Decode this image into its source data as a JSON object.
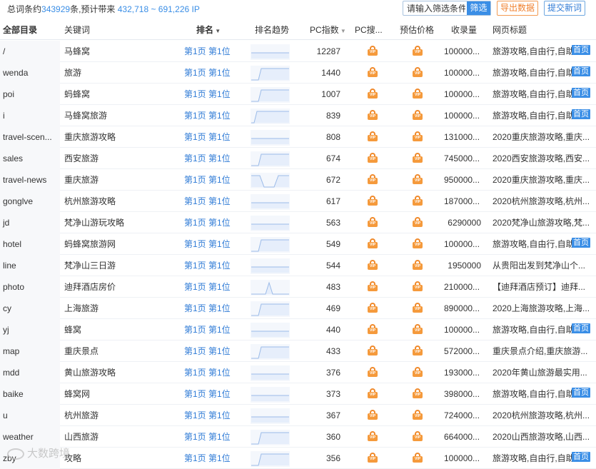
{
  "summary": {
    "prefix": "总词条约",
    "count": "343929",
    "middle": "条,预计带来 ",
    "ip_range": "432,718 ~ 691,226",
    "suffix": " IP"
  },
  "toolbar": {
    "filter_placeholder": "请输入筛选条件",
    "filter_label": "筛选",
    "export_label": "导出数据",
    "submit_label": "提交新词"
  },
  "columns": {
    "dir": "全部目录",
    "keyword": "关键词",
    "rank": "排名",
    "trend": "排名趋势",
    "pc_index": "PC指数",
    "pc_search": "PC搜...",
    "price": "预估价格",
    "volume": "收录量",
    "title": "网页标题"
  },
  "badge_label": "首页",
  "rows": [
    {
      "dir": "/",
      "keyword": "马蜂窝",
      "rank": "第1页 第1位",
      "trend": "flat",
      "pc": "12287",
      "volume": "100000...",
      "title": "旅游攻略,自由行,自助",
      "badge": true
    },
    {
      "dir": "wenda",
      "keyword": "旅游",
      "rank": "第1页 第1位",
      "trend": "rise",
      "pc": "1440",
      "volume": "100000...",
      "title": "旅游攻略,自由行,自助",
      "badge": true
    },
    {
      "dir": "poi",
      "keyword": "蚂蜂窝",
      "rank": "第1页 第1位",
      "trend": "rise",
      "pc": "1007",
      "volume": "100000...",
      "title": "旅游攻略,自由行,自助",
      "badge": true
    },
    {
      "dir": "i",
      "keyword": "马蜂窝旅游",
      "rank": "第1页 第1位",
      "trend": "rise-early",
      "pc": "839",
      "volume": "100000...",
      "title": "旅游攻略,自由行,自助",
      "badge": true
    },
    {
      "dir": "travel-scen...",
      "keyword": "重庆旅游攻略",
      "rank": "第1页 第1位",
      "trend": "flat",
      "pc": "808",
      "volume": "131000...",
      "title": "2020重庆旅游攻略,重庆...",
      "badge": false
    },
    {
      "dir": "sales",
      "keyword": "西安旅游",
      "rank": "第1页 第1位",
      "trend": "rise",
      "pc": "674",
      "volume": "745000...",
      "title": "2020西安旅游攻略,西安...",
      "badge": false
    },
    {
      "dir": "travel-news",
      "keyword": "重庆旅游",
      "rank": "第1页 第1位",
      "trend": "dip",
      "pc": "672",
      "volume": "950000...",
      "title": "2020重庆旅游攻略,重庆...",
      "badge": false
    },
    {
      "dir": "gonglve",
      "keyword": "杭州旅游攻略",
      "rank": "第1页 第1位",
      "trend": "flat",
      "pc": "617",
      "volume": "187000...",
      "title": "2020杭州旅游攻略,杭州...",
      "badge": false
    },
    {
      "dir": "jd",
      "keyword": "梵净山游玩攻略",
      "rank": "第1页 第1位",
      "trend": "flat",
      "pc": "563",
      "volume": "6290000",
      "volume_right": true,
      "title": "2020梵净山旅游攻略,梵...",
      "badge": false
    },
    {
      "dir": "hotel",
      "keyword": "蚂蜂窝旅游网",
      "rank": "第1页 第1位",
      "trend": "rise",
      "pc": "549",
      "volume": "100000...",
      "title": "旅游攻略,自由行,自助",
      "badge": true
    },
    {
      "dir": "line",
      "keyword": "梵净山三日游",
      "rank": "第1页 第1位",
      "trend": "flat",
      "pc": "544",
      "volume": "1950000",
      "volume_right": true,
      "title": "从贵阳出发到梵净山个...",
      "badge": false
    },
    {
      "dir": "photo",
      "keyword": "迪拜酒店房价",
      "rank": "第1页 第1位",
      "trend": "peak",
      "pc": "483",
      "volume": "210000...",
      "title": "【迪拜酒店预订】迪拜...",
      "badge": false
    },
    {
      "dir": "cy",
      "keyword": "上海旅游",
      "rank": "第1页 第1位",
      "trend": "rise",
      "pc": "469",
      "volume": "890000...",
      "title": "2020上海旅游攻略,上海...",
      "badge": false
    },
    {
      "dir": "yj",
      "keyword": "蜂窝",
      "rank": "第1页 第1位",
      "trend": "flat",
      "pc": "440",
      "volume": "100000...",
      "title": "旅游攻略,自由行,自助",
      "badge": true
    },
    {
      "dir": "map",
      "keyword": "重庆景点",
      "rank": "第1页 第1位",
      "trend": "rise",
      "pc": "433",
      "volume": "572000...",
      "title": "重庆景点介绍,重庆旅游...",
      "badge": false
    },
    {
      "dir": "mdd",
      "keyword": "黄山旅游攻略",
      "rank": "第1页 第1位",
      "trend": "flat",
      "pc": "376",
      "volume": "193000...",
      "title": "2020年黄山旅游最实用...",
      "badge": false
    },
    {
      "dir": "baike",
      "keyword": "蜂窝网",
      "rank": "第1页 第1位",
      "trend": "flat",
      "pc": "373",
      "volume": "398000...",
      "title": "旅游攻略,自由行,自助",
      "badge": true
    },
    {
      "dir": "u",
      "keyword": "杭州旅游",
      "rank": "第1页 第1位",
      "trend": "flat",
      "pc": "367",
      "volume": "724000...",
      "title": "2020杭州旅游攻略,杭州...",
      "badge": false
    },
    {
      "dir": "weather",
      "keyword": "山西旅游",
      "rank": "第1页 第1位",
      "trend": "rise",
      "pc": "360",
      "volume": "664000...",
      "title": "2020山西旅游攻略,山西...",
      "badge": false
    },
    {
      "dir": "zby",
      "keyword": "攻略",
      "rank": "第1页 第1位",
      "trend": "rise",
      "pc": "356",
      "volume": "100000...",
      "title": "旅游攻略,自由行,自助",
      "badge": true
    }
  ],
  "watermark": "大数跨境",
  "colors": {
    "link": "#2f7bd6",
    "accent": "#3a8ee6",
    "vip": "#f59a3c",
    "export": "#f07f2b"
  }
}
